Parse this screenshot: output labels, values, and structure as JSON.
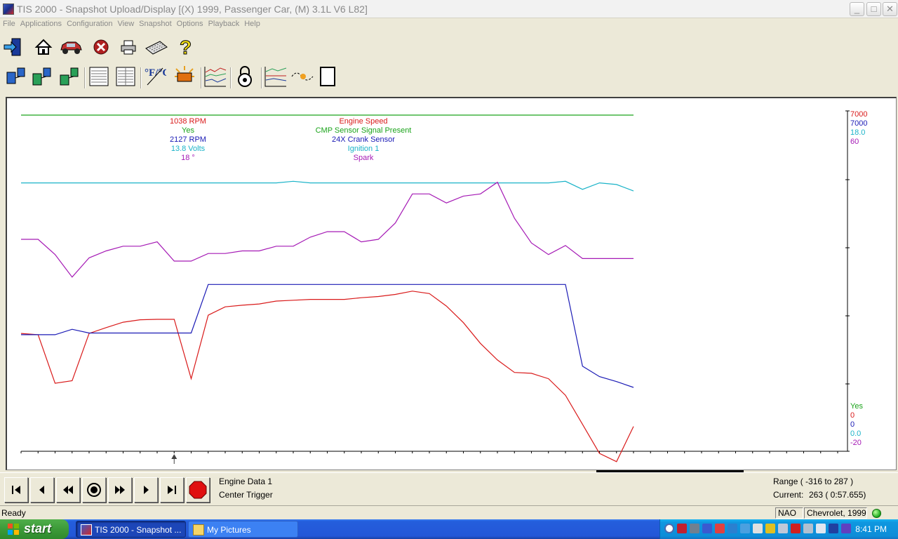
{
  "window": {
    "title": "TIS 2000 - Snapshot Upload/Display [(X) 1999, Passenger Car, (M) 3.1L   V6 L82]",
    "controls": {
      "minimize": "_",
      "maximize": "□",
      "close": "✕"
    }
  },
  "menu": [
    "File",
    "Applications",
    "Configuration",
    "View",
    "Snapshot",
    "Options",
    "Playback",
    "Help"
  ],
  "toolbar1": [
    "exit-icon",
    "home-icon",
    "car-icon",
    "stop-icon",
    "printer-icon",
    "keyboard-icon",
    "help-icon"
  ],
  "toolbar2": [
    "scan-tool-1-icon",
    "scan-tool-2-icon",
    "scan-tool-3-icon",
    "list-view-icon",
    "table-view-icon",
    "units-fc-icon",
    "trigger-icon",
    "graph-icon",
    "lock-icon",
    "graph-compare-icon",
    "spark-icon",
    "blank-page-icon"
  ],
  "units_label": "°F/°C",
  "chart_data": {
    "type": "line",
    "grid": false,
    "x_cursor_sample": 9,
    "legend_values": [
      "1038 RPM",
      "Yes",
      "2127 RPM",
      "13.8 Volts",
      "18 °"
    ],
    "legend_names": [
      "Engine Speed",
      "CMP Sensor Signal Present",
      "24X Crank Sensor",
      "Ignition 1",
      "Spark"
    ],
    "axis_max_labels": [
      "7000",
      "7000",
      "18.0",
      "60"
    ],
    "axis_min_labels": [
      "Yes",
      "0",
      "0",
      "0.0",
      "-20"
    ],
    "series": [
      {
        "name": "Engine Speed",
        "color": "#d91a1a",
        "ylim": [
          0,
          7000
        ],
        "values": [
          1740,
          1710,
          540,
          600,
          1740,
          1880,
          2010,
          2070,
          2080,
          2080,
          650,
          2180,
          2380,
          2420,
          2450,
          2520,
          2540,
          2560,
          2560,
          2560,
          2600,
          2630,
          2680,
          2760,
          2700,
          2400,
          2000,
          1500,
          1100,
          800,
          780,
          650,
          250,
          -450,
          -1150,
          -1350,
          -500
        ]
      },
      {
        "name": "CMP Sensor Signal Present",
        "color": "#1aa31a",
        "ylim": [
          0,
          1
        ],
        "values": [
          1,
          1,
          1,
          1,
          1,
          1,
          1,
          1,
          1,
          1,
          1,
          1,
          1,
          1,
          1,
          1,
          1,
          1,
          1,
          1,
          1,
          1,
          1,
          1,
          1,
          1,
          1,
          1,
          1,
          1,
          1,
          1,
          1,
          1,
          1,
          1,
          1
        ]
      },
      {
        "name": "24X Crank Sensor",
        "color": "#1a1ab5",
        "ylim": [
          0,
          7000
        ],
        "values": [
          1710,
          1710,
          1710,
          1840,
          1750,
          1750,
          1750,
          1750,
          1750,
          1750,
          1750,
          2920,
          2920,
          2920,
          2920,
          2920,
          2920,
          2920,
          2920,
          2920,
          2920,
          2920,
          2920,
          2920,
          2920,
          2920,
          2920,
          2920,
          2920,
          2920,
          2920,
          2920,
          2920,
          950,
          700,
          580,
          440
        ]
      },
      {
        "name": "Ignition 1",
        "color": "#1ab3c8",
        "ylim": [
          0,
          18
        ],
        "values": [
          13.8,
          13.8,
          13.8,
          13.8,
          13.8,
          13.8,
          13.8,
          13.8,
          13.8,
          13.8,
          13.8,
          13.8,
          13.8,
          13.8,
          13.8,
          13.8,
          13.9,
          13.8,
          13.8,
          13.8,
          13.8,
          13.8,
          13.8,
          13.8,
          13.8,
          13.8,
          13.8,
          13.8,
          13.8,
          13.8,
          13.8,
          13.8,
          13.9,
          13.4,
          13.8,
          13.7,
          13.3
        ]
      },
      {
        "name": "Spark",
        "color": "#a51ab5",
        "ylim": [
          -20,
          60
        ],
        "values": [
          25.8,
          25.8,
          21.6,
          15.4,
          20.7,
          22.6,
          23.9,
          23.9,
          25.1,
          19.8,
          19.8,
          21.9,
          21.9,
          22.6,
          22.6,
          23.9,
          23.9,
          26.4,
          27.9,
          27.9,
          25.1,
          25.8,
          30.3,
          38.3,
          38.3,
          35.8,
          37.7,
          38.3,
          41.5,
          31.6,
          24.8,
          21.6,
          24.1,
          20.5,
          20.5,
          20.5,
          20.5
        ]
      }
    ]
  },
  "playback": {
    "buttons": [
      "first-icon",
      "prev-icon",
      "rewind-icon",
      "record-icon",
      "fast-forward-icon",
      "next-icon",
      "last-icon",
      "stop-red-icon"
    ],
    "data_list": "Engine Data 1",
    "trigger_mode": "Center Trigger",
    "range": "Range ( -316 to 287 )",
    "current_label": "Current:",
    "current_value": "263 ( 0:57.655)"
  },
  "status": {
    "text": "Ready",
    "region": "NAO",
    "vehicle": "Chevrolet, 1999"
  },
  "taskbar": {
    "start": "start",
    "tasks": [
      "TIS 2000 - Snapshot ...",
      "My Pictures"
    ],
    "clock": "8:41 PM"
  }
}
